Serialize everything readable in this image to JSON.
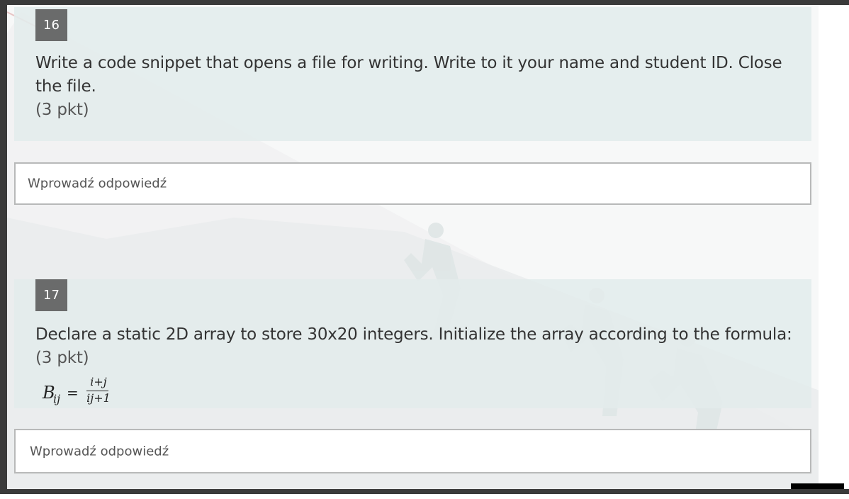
{
  "questions": [
    {
      "number": "16",
      "text": "Write a code snippet that opens a file for writing. Write to it your name and student ID. Close the file.",
      "points": "(3 pkt)",
      "answer_placeholder": "Wprowadź odpowiedź"
    },
    {
      "number": "17",
      "text": "Declare a static 2D array to store 30x20 integers. Initialize the array according to the formula:",
      "points": "(3 pkt)",
      "formula": {
        "lhs": "B",
        "lhs_subscript": "ij",
        "equals": "=",
        "numerator": "i+j",
        "denominator": "ij+1"
      },
      "answer_placeholder": "Wprowadź odpowiedź"
    }
  ],
  "colors": {
    "card_background": "#e2ecec",
    "number_badge": "#6a6b6b",
    "input_border": "#b8b9b9"
  }
}
